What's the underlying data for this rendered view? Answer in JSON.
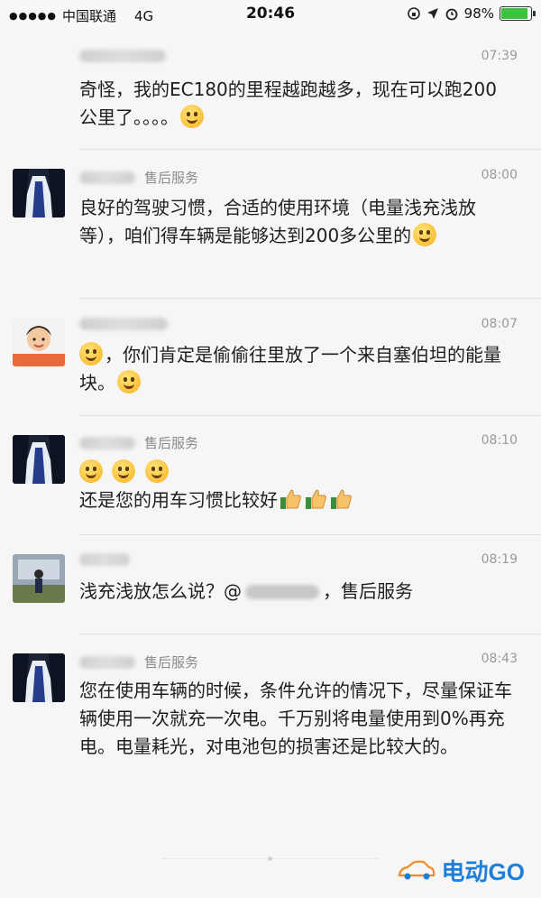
{
  "status_bar": {
    "signal_dots": "●●●●●",
    "carrier": "中国联通",
    "network": "4G",
    "time": "20:46",
    "battery_percent": "98%",
    "battery_level": 0.98,
    "battery_color": "#3cc23c"
  },
  "messages": [
    {
      "role": "",
      "time": "07:39",
      "text": "奇怪，我的EC180的里程越跑越多，现在可以跑200公里了。。。。"
    },
    {
      "role": "售后服务",
      "time": "08:00",
      "text": "良好的驾驶习惯，合适的使用环境（电量浅充浅放等），咱们得车辆是能够达到200多公里的"
    },
    {
      "role": "",
      "time": "08:07",
      "text": "，你们肯定是偷偷往里放了一个来自塞伯坦的能量块。"
    },
    {
      "role": "售后服务",
      "time": "08:10",
      "text": "还是您的用车习惯比较好"
    },
    {
      "role": "",
      "time": "08:19",
      "text_before": "浅充浅放怎么说？@",
      "text_after": "，售后服务"
    },
    {
      "role": "售后服务",
      "time": "08:43",
      "text": "您在使用车辆的时候，条件允许的情况下，尽量保证车辆使用一次就充一次电。千万别将电量使用到0%再充电。电量耗光，对电池包的损害还是比较大的。"
    }
  ],
  "watermark": {
    "text": "电动GO",
    "color": "#1e7fd8"
  }
}
